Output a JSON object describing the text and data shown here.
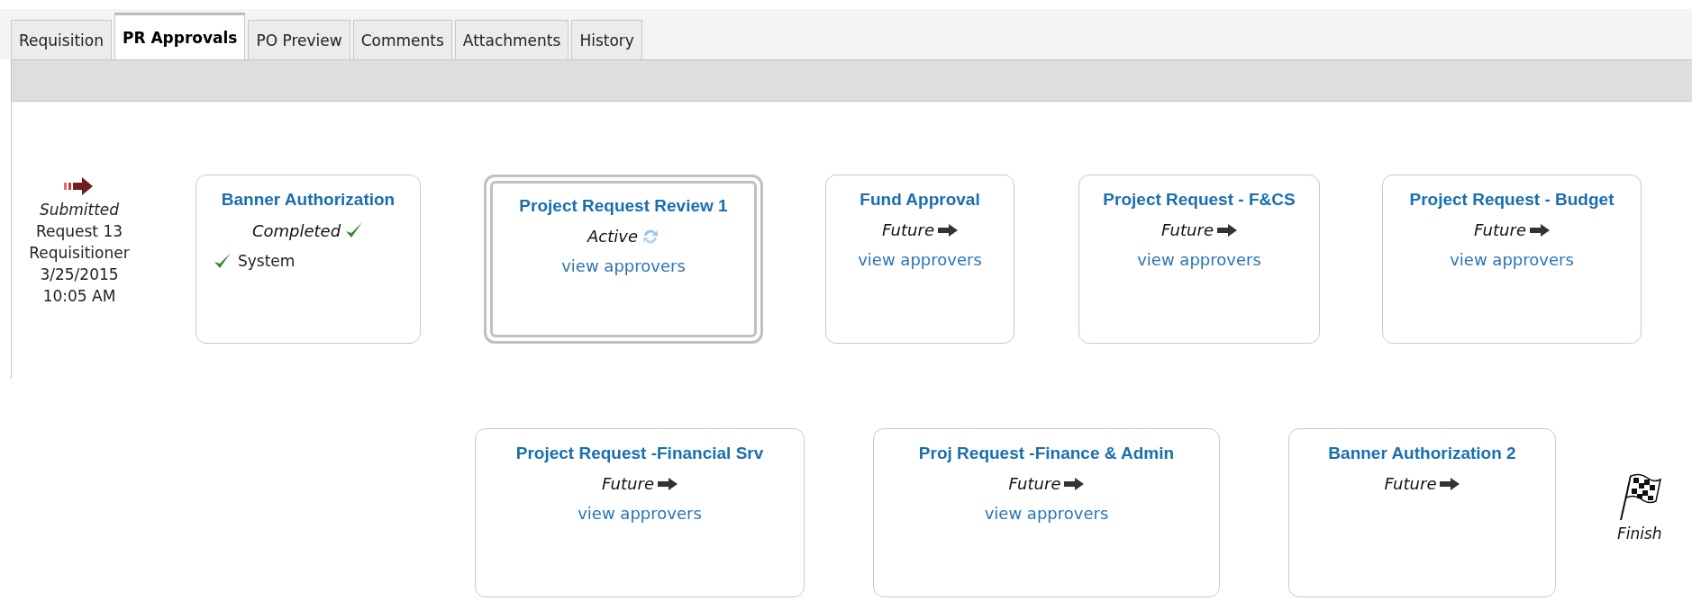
{
  "tabs": [
    {
      "label": "Requisition",
      "selected": false
    },
    {
      "label": "PR Approvals",
      "selected": true
    },
    {
      "label": "PO Preview",
      "selected": false
    },
    {
      "label": "Comments",
      "selected": false
    },
    {
      "label": "Attachments",
      "selected": false
    },
    {
      "label": "History",
      "selected": false
    }
  ],
  "submitted": {
    "status": "Submitted",
    "lines": [
      "Request 13",
      "Requisitioner",
      "3/25/2015",
      "10:05 AM"
    ]
  },
  "steps": [
    {
      "title": "Banner Authorization",
      "kind": "completed",
      "status": "Completed",
      "approvers": [
        "System"
      ]
    },
    {
      "title": "Project Request Review 1",
      "kind": "active",
      "status": "Active",
      "link": "view approvers"
    },
    {
      "title": "Fund Approval",
      "kind": "future",
      "status": "Future",
      "link": "view approvers"
    },
    {
      "title": "Project Request - F&CS",
      "kind": "future",
      "status": "Future",
      "link": "view approvers"
    },
    {
      "title": "Project Request - Budget",
      "kind": "future",
      "status": "Future",
      "link": "view approvers"
    },
    {
      "title": "Project Request -Financial Srv",
      "kind": "future",
      "status": "Future",
      "link": "view approvers"
    },
    {
      "title": "Proj Request -Finance & Admin",
      "kind": "future",
      "status": "Future",
      "link": "view approvers"
    },
    {
      "title": "Banner Authorization 2",
      "kind": "future",
      "status": "Future"
    }
  ],
  "finish": {
    "label": "Finish"
  }
}
